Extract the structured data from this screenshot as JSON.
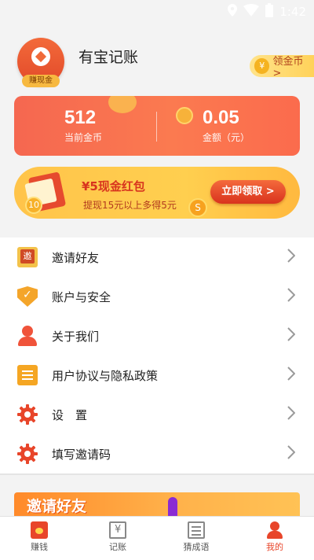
{
  "status_bar": {
    "time": "1:42",
    "icons": [
      "location-icon",
      "wifi-icon",
      "battery-icon"
    ]
  },
  "header": {
    "avatar_badge": "赚现金",
    "app_name": "有宝记账",
    "coin_pill": "领金币 >"
  },
  "stats": {
    "coins_value": "512",
    "coins_label": "当前金币",
    "amount_value": "0.05",
    "amount_label": "金额（元）"
  },
  "red_packet": {
    "coin_text": "10",
    "title": "¥5现金红包",
    "subtitle": "提现15元以上多得5元",
    "coin_s": "S",
    "button": "立即领取 >"
  },
  "menu": [
    {
      "icon": "invite-icon",
      "label": "邀请好友"
    },
    {
      "icon": "shield-icon",
      "label": "账户与安全"
    },
    {
      "icon": "person-icon",
      "label": "关于我们"
    },
    {
      "icon": "document-icon",
      "label": "用户协议与隐私政策"
    },
    {
      "icon": "gear-icon",
      "label": "设　置"
    },
    {
      "icon": "gear-icon",
      "label": "填写邀请码"
    }
  ],
  "banner": {
    "text": "邀请好友"
  },
  "tabs": [
    {
      "icon": "red-envelope-icon",
      "label": "赚钱"
    },
    {
      "icon": "ledger-icon",
      "label": "记账"
    },
    {
      "icon": "idiom-book-icon",
      "label": "猜成语"
    },
    {
      "icon": "person-icon",
      "label": "我的",
      "active": true
    }
  ],
  "colors": {
    "accent": "#e8452a",
    "gold": "#ffc44a",
    "card": "#f56750"
  }
}
